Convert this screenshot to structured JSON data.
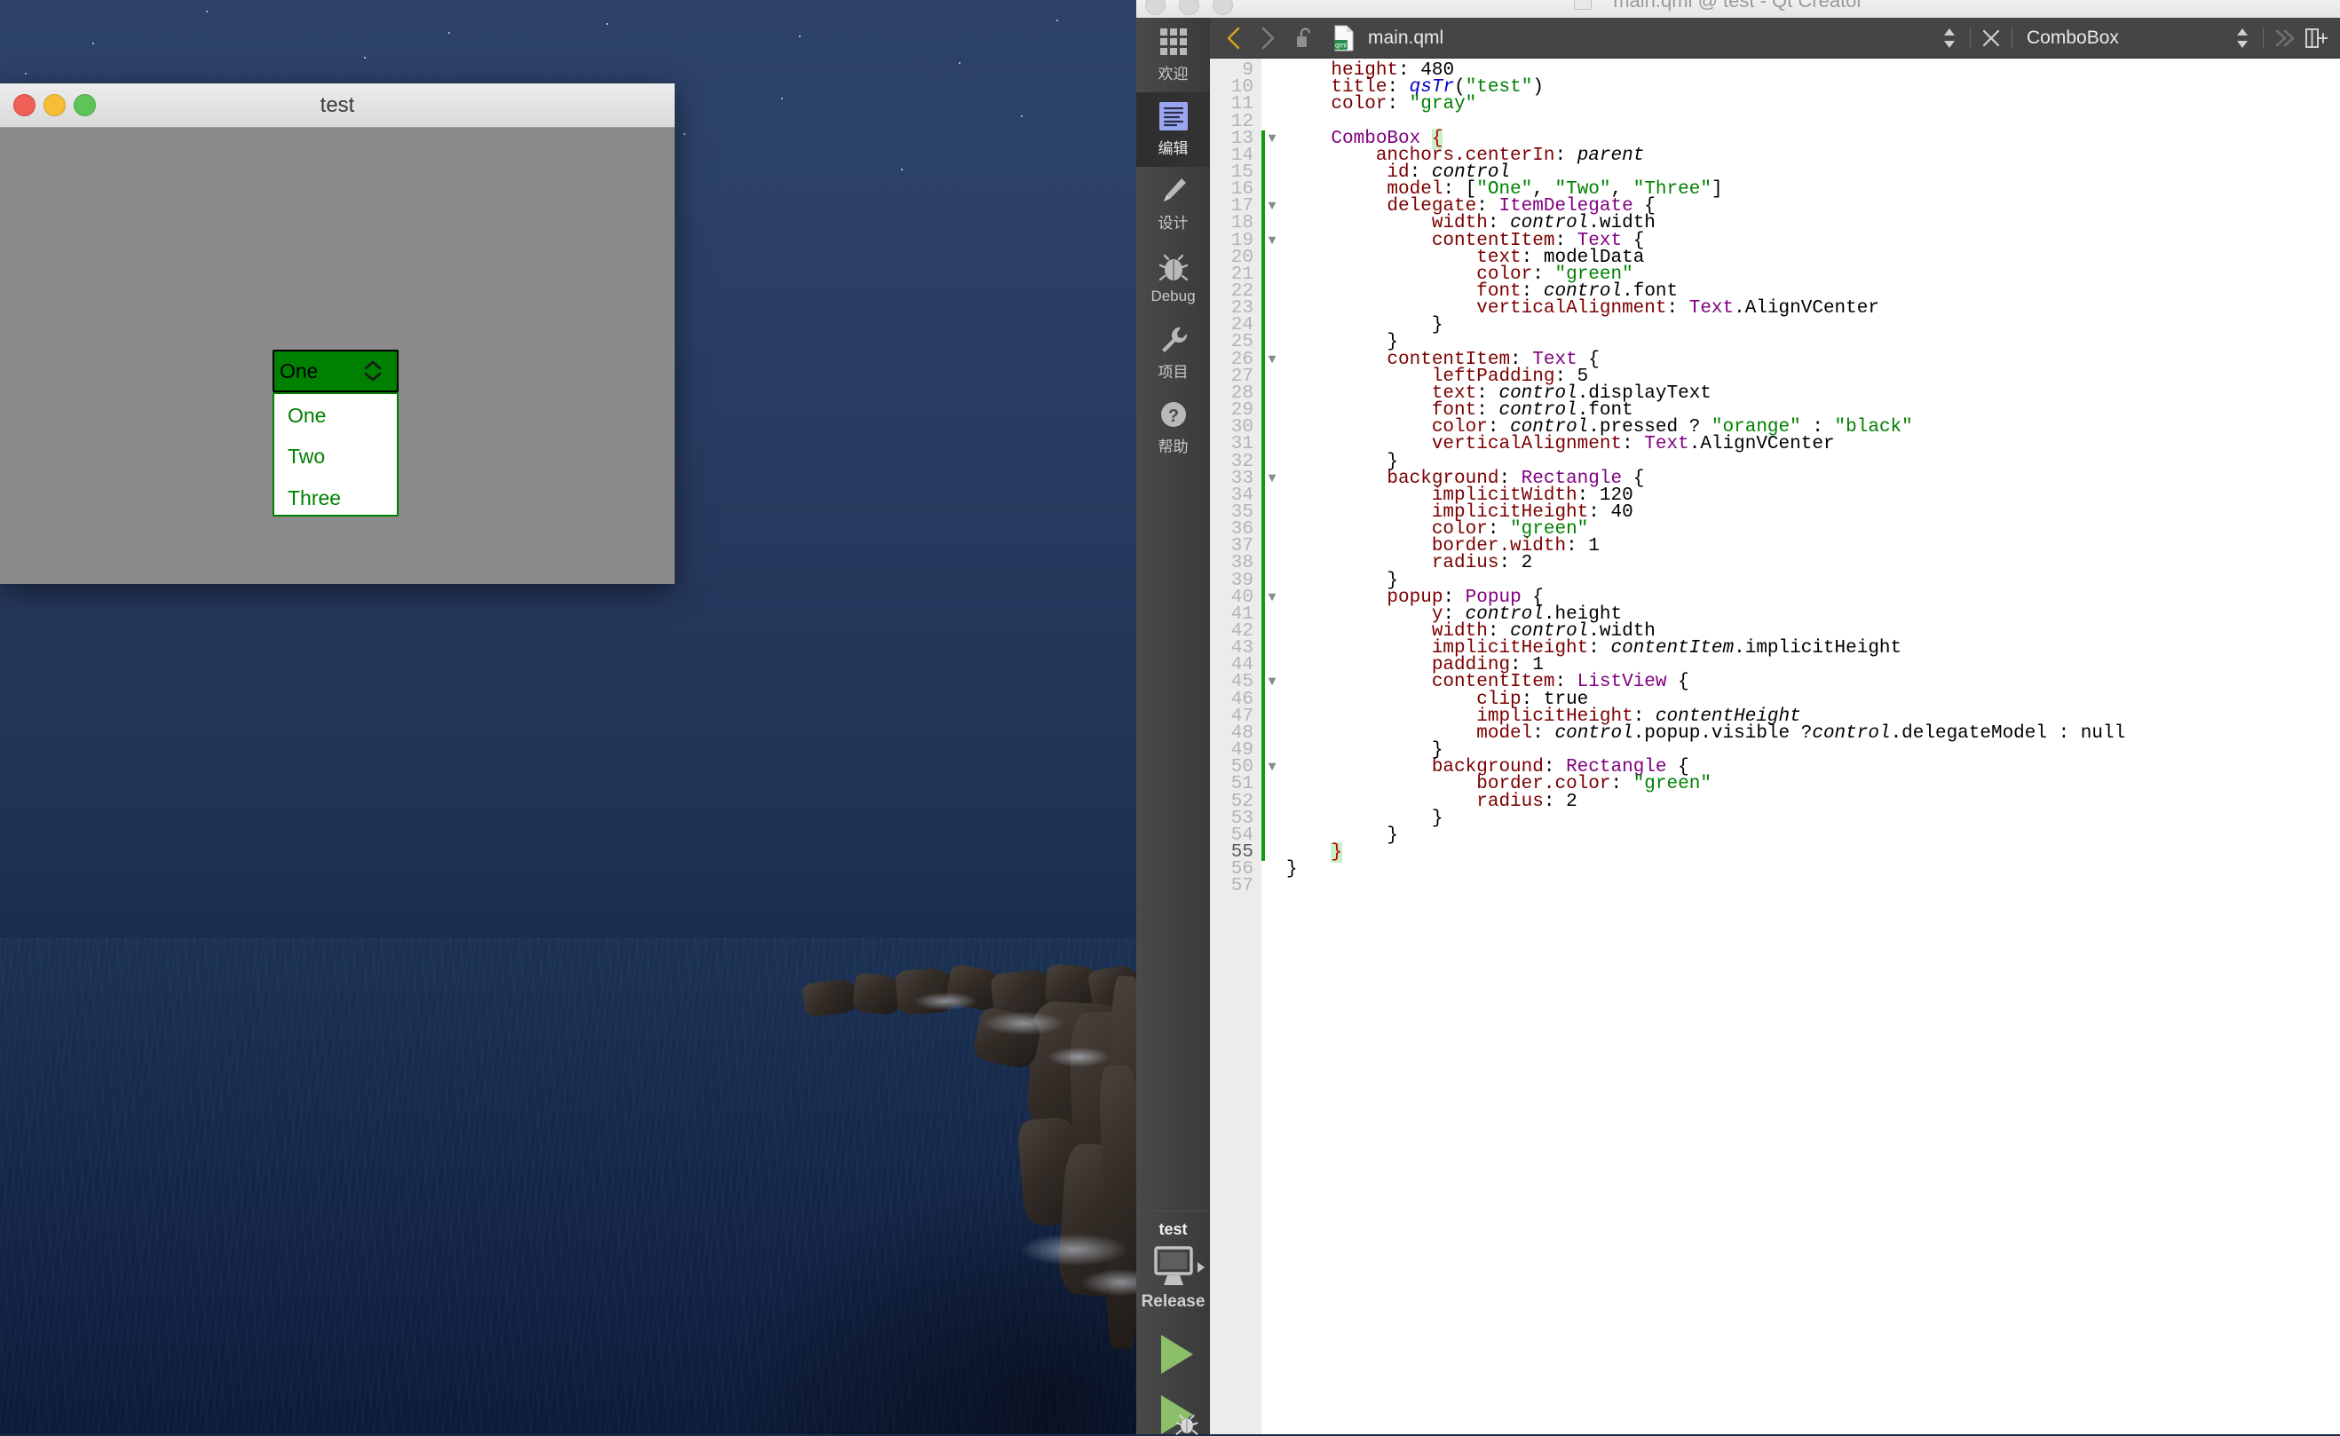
{
  "desktop": {
    "wallpaper_name": "night-ocean-cliff-wallpaper"
  },
  "qml_app": {
    "title": "test",
    "window_controls": [
      "close",
      "minimize",
      "zoom"
    ],
    "combobox": {
      "display_text": "One",
      "indicator_icon": "up-down-chevron-icon",
      "background_color": "#008000",
      "text_color": "#000000",
      "popup_open": true,
      "popup_border_color": "#008000",
      "items": [
        "One",
        "Two",
        "Three"
      ],
      "item_text_color": "#008000"
    }
  },
  "qt_creator": {
    "window_title": "main.qml @ test - Qt Creator",
    "window_controls": [
      "close",
      "minimize",
      "zoom"
    ],
    "modebar": {
      "items": [
        {
          "label": "欢迎",
          "icon": "grid-icon",
          "active": false
        },
        {
          "label": "编辑",
          "icon": "document-lines-icon",
          "active": true
        },
        {
          "label": "设计",
          "icon": "pencil-icon",
          "active": false
        },
        {
          "label": "Debug",
          "icon": "bug-icon",
          "active": false
        },
        {
          "label": "项目",
          "icon": "wrench-icon",
          "active": false
        },
        {
          "label": "帮助",
          "icon": "question-circle-icon",
          "active": false
        }
      ],
      "kit_name": "test",
      "kit_config": "Release",
      "kit_icon": "desktop-monitor-icon",
      "kit_expand_icon": "chevron-right-icon",
      "run_button_icon": "play-triangle-icon",
      "debug_button_icon": "play-bug-icon"
    },
    "editor_toolbar": {
      "back_icon": "chevron-left-icon",
      "forward_icon": "chevron-right-icon",
      "lock_icon": "unlocked-padlock-icon",
      "file_type_icon": "qml-file-icon",
      "file_name": "main.qml",
      "file_updown_icon": "up-down-arrows-icon",
      "close_icon": "close-x-icon",
      "symbol_name": "ComboBox",
      "symbol_updown_icon": "up-down-arrows-icon",
      "collapse_icon": "double-chevron-right-icon",
      "split_icon": "split-editor-icon"
    },
    "editor": {
      "current_line": 55,
      "change_bar_from_line": 13,
      "lines": [
        {
          "n": 9,
          "fold": "",
          "html": "    <span class='kw'>height</span>: <span class='num'>480</span>"
        },
        {
          "n": 10,
          "fold": "",
          "html": "    <span class='kw'>title</span>: <span class='fn'>qsTr</span>(<span class='str'>\"test\"</span>)"
        },
        {
          "n": 11,
          "fold": "",
          "html": "    <span class='kw'>color</span>: <span class='str'>\"gray\"</span>"
        },
        {
          "n": 12,
          "fold": "",
          "html": ""
        },
        {
          "n": 13,
          "fold": "▼",
          "html": "    <span class='typ'>ComboBox</span> <span class='brace-hl'>{</span>"
        },
        {
          "n": 14,
          "fold": "",
          "html": "        <span class='kw'>anchors.centerIn</span>: <span class='id'>parent</span>"
        },
        {
          "n": 15,
          "fold": "",
          "html": "         <span class='kw'>id</span>: <span class='id'>control</span>"
        },
        {
          "n": 16,
          "fold": "",
          "html": "         <span class='kw'>model</span>: [<span class='str'>\"One\"</span>, <span class='str'>\"Two\"</span>, <span class='str'>\"Three\"</span>]"
        },
        {
          "n": 17,
          "fold": "▼",
          "html": "         <span class='kw'>delegate</span>: <span class='typ'>ItemDelegate</span> {"
        },
        {
          "n": 18,
          "fold": "",
          "html": "             <span class='kw'>width</span>: <span class='id'>control</span>.width"
        },
        {
          "n": 19,
          "fold": "▼",
          "html": "             <span class='kw'>contentItem</span>: <span class='typ'>Text</span> {"
        },
        {
          "n": 20,
          "fold": "",
          "html": "                 <span class='kw'>text</span>: modelData"
        },
        {
          "n": 21,
          "fold": "",
          "html": "                 <span class='kw'>color</span>: <span class='str'>\"green\"</span>"
        },
        {
          "n": 22,
          "fold": "",
          "html": "                 <span class='kw'>font</span>: <span class='id'>control</span>.font"
        },
        {
          "n": 23,
          "fold": "",
          "html": "                 <span class='kw'>verticalAlignment</span>: <span class='typ'>Text</span>.AlignVCenter"
        },
        {
          "n": 24,
          "fold": "",
          "html": "             }"
        },
        {
          "n": 25,
          "fold": "",
          "html": "         }"
        },
        {
          "n": 26,
          "fold": "▼",
          "html": "         <span class='kw'>contentItem</span>: <span class='typ'>Text</span> {"
        },
        {
          "n": 27,
          "fold": "",
          "html": "             <span class='kw'>leftPadding</span>: <span class='num'>5</span>"
        },
        {
          "n": 28,
          "fold": "",
          "html": "             <span class='kw'>text</span>: <span class='id'>control</span>.displayText"
        },
        {
          "n": 29,
          "fold": "",
          "html": "             <span class='kw'>font</span>: <span class='id'>control</span>.font"
        },
        {
          "n": 30,
          "fold": "",
          "html": "             <span class='kw'>color</span>: <span class='id'>control</span>.pressed ? <span class='str'>\"orange\"</span> : <span class='str'>\"black\"</span>"
        },
        {
          "n": 31,
          "fold": "",
          "html": "             <span class='kw'>verticalAlignment</span>: <span class='typ'>Text</span>.AlignVCenter"
        },
        {
          "n": 32,
          "fold": "",
          "html": "         }"
        },
        {
          "n": 33,
          "fold": "▼",
          "html": "         <span class='kw'>background</span>: <span class='typ'>Rectangle</span> {"
        },
        {
          "n": 34,
          "fold": "",
          "html": "             <span class='kw'>implicitWidth</span>: <span class='num'>120</span>"
        },
        {
          "n": 35,
          "fold": "",
          "html": "             <span class='kw'>implicitHeight</span>: <span class='num'>40</span>"
        },
        {
          "n": 36,
          "fold": "",
          "html": "             <span class='kw'>color</span>: <span class='str'>\"green\"</span>"
        },
        {
          "n": 37,
          "fold": "",
          "html": "             <span class='kw'>border.width</span>: <span class='num'>1</span>"
        },
        {
          "n": 38,
          "fold": "",
          "html": "             <span class='kw'>radius</span>: <span class='num'>2</span>"
        },
        {
          "n": 39,
          "fold": "",
          "html": "         }"
        },
        {
          "n": 40,
          "fold": "▼",
          "html": "         <span class='kw'>popup</span>: <span class='typ'>Popup</span> {"
        },
        {
          "n": 41,
          "fold": "",
          "html": "             <span class='kw'>y</span>: <span class='id'>control</span>.height"
        },
        {
          "n": 42,
          "fold": "",
          "html": "             <span class='kw'>width</span>: <span class='id'>control</span>.width"
        },
        {
          "n": 43,
          "fold": "",
          "html": "             <span class='kw'>implicitHeight</span>: <span class='id'>contentItem</span>.implicitHeight"
        },
        {
          "n": 44,
          "fold": "",
          "html": "             <span class='kw'>padding</span>: <span class='num'>1</span>"
        },
        {
          "n": 45,
          "fold": "▼",
          "html": "             <span class='kw'>contentItem</span>: <span class='typ'>ListView</span> {"
        },
        {
          "n": 46,
          "fold": "",
          "html": "                 <span class='kw'>clip</span>: true"
        },
        {
          "n": 47,
          "fold": "",
          "html": "                 <span class='kw'>implicitHeight</span>: <span class='id'>contentHeight</span>"
        },
        {
          "n": 48,
          "fold": "",
          "html": "                 <span class='kw'>model</span>: <span class='id'>control</span>.popup.visible ?<span class='id'>control</span>.delegateModel : null"
        },
        {
          "n": 49,
          "fold": "",
          "html": "             }"
        },
        {
          "n": 50,
          "fold": "▼",
          "html": "             <span class='kw'>background</span>: <span class='typ'>Rectangle</span> {"
        },
        {
          "n": 51,
          "fold": "",
          "html": "                 <span class='kw'>border.color</span>: <span class='str'>\"green\"</span>"
        },
        {
          "n": 52,
          "fold": "",
          "html": "                 <span class='kw'>radius</span>: <span class='num'>2</span>"
        },
        {
          "n": 53,
          "fold": "",
          "html": "             }"
        },
        {
          "n": 54,
          "fold": "",
          "html": "         }"
        },
        {
          "n": 55,
          "fold": "",
          "html": "    <span class='brace-hl'>}</span>"
        },
        {
          "n": 56,
          "fold": "",
          "html": "}"
        },
        {
          "n": 57,
          "fold": "",
          "html": ""
        }
      ]
    }
  }
}
